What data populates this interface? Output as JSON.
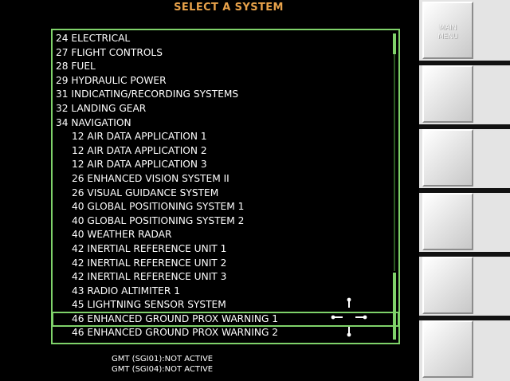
{
  "header": {
    "title": "SELECT A SYSTEM"
  },
  "system_list": {
    "items": [
      {
        "label": "24 ELECTRICAL",
        "level": 0
      },
      {
        "label": "27 FLIGHT CONTROLS",
        "level": 0
      },
      {
        "label": "28 FUEL",
        "level": 0
      },
      {
        "label": "29 HYDRAULIC POWER",
        "level": 0
      },
      {
        "label": "31 INDICATING/RECORDING SYSTEMS",
        "level": 0
      },
      {
        "label": "32 LANDING GEAR",
        "level": 0
      },
      {
        "label": "34 NAVIGATION",
        "level": 0
      },
      {
        "label": "12 AIR DATA APPLICATION 1",
        "level": 1
      },
      {
        "label": "12 AIR DATA APPLICATION 2",
        "level": 1
      },
      {
        "label": "12 AIR DATA APPLICATION 3",
        "level": 1
      },
      {
        "label": "26 ENHANCED VISION SYSTEM II",
        "level": 1
      },
      {
        "label": "26 VISUAL GUIDANCE SYSTEM",
        "level": 1
      },
      {
        "label": "40 GLOBAL POSITIONING SYSTEM 1",
        "level": 1
      },
      {
        "label": "40 GLOBAL POSITIONING SYSTEM 2",
        "level": 1
      },
      {
        "label": "40 WEATHER RADAR",
        "level": 1
      },
      {
        "label": "42 INERTIAL REFERENCE UNIT 1",
        "level": 1
      },
      {
        "label": "42 INERTIAL REFERENCE UNIT 2",
        "level": 1
      },
      {
        "label": "42 INERTIAL REFERENCE UNIT 3",
        "level": 1
      },
      {
        "label": "43 RADIO ALTIMITER 1",
        "level": 1
      },
      {
        "label": "45 LIGHTNING SENSOR SYSTEM",
        "level": 1
      },
      {
        "label": "46 ENHANCED GROUND PROX WARNING 1",
        "level": 1,
        "selected": true
      },
      {
        "label": "46 ENHANCED GROUND PROX WARNING 2",
        "level": 1
      }
    ]
  },
  "status": {
    "line1": "GMT (SGI01):NOT ACTIVE",
    "line2": "GMT (SGI04):NOT ACTIVE"
  },
  "side_buttons": [
    {
      "line1": "MAIN",
      "line2": "MENU"
    },
    {
      "line1": "",
      "line2": ""
    },
    {
      "line1": "",
      "line2": ""
    },
    {
      "line1": "",
      "line2": ""
    },
    {
      "line1": "",
      "line2": ""
    },
    {
      "line1": "",
      "line2": ""
    }
  ],
  "colors": {
    "title": "#e8a24a",
    "frame": "#7fd26a",
    "text": "#ffffff",
    "background": "#000000"
  },
  "icons": {
    "cursor": "crosshair-cursor-icon"
  }
}
